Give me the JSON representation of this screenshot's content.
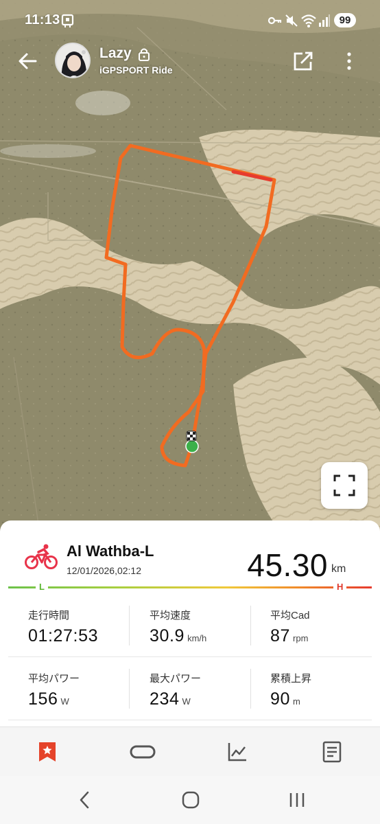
{
  "status_bar": {
    "time": "11:13",
    "battery": "99",
    "icons": [
      "app-notification-icon",
      "key-icon",
      "mute-icon",
      "wifi-icon",
      "signal-icon",
      "battery-icon"
    ]
  },
  "header": {
    "user_name": "Lazy",
    "subtitle": "iGPSPORT Ride",
    "icons": [
      "back-arrow-icon",
      "lock-icon",
      "share-icon",
      "more-vert-icon"
    ]
  },
  "map": {
    "track_color": "#f26b21",
    "start_marker_color": "#3cb04a",
    "fullscreen_icon": "fullscreen-icon"
  },
  "activity": {
    "name": "Al Wathba-L",
    "datetime": "12/01/2026,02:12",
    "distance": "45.30",
    "distance_unit": "km",
    "sport_icon": "cycling-icon",
    "sport_color": "#e8334a",
    "gradient_low_label": "L",
    "gradient_high_label": "H"
  },
  "stats": [
    {
      "label": "走行時間",
      "value": "01:27:53",
      "unit": ""
    },
    {
      "label": "平均速度",
      "value": "30.9",
      "unit": "km/h"
    },
    {
      "label": "平均Cad",
      "value": "87",
      "unit": "rpm"
    },
    {
      "label": "平均パワー",
      "value": "156",
      "unit": "W"
    },
    {
      "label": "最大パワー",
      "value": "234",
      "unit": "W"
    },
    {
      "label": "累積上昇",
      "value": "90",
      "unit": "m"
    }
  ],
  "tabs": [
    {
      "icon": "bookmark-star-icon",
      "active": true,
      "color": "#e5432a"
    },
    {
      "icon": "loop-route-icon",
      "active": false,
      "color": "#555555"
    },
    {
      "icon": "chart-line-icon",
      "active": false,
      "color": "#555555"
    },
    {
      "icon": "document-list-icon",
      "active": false,
      "color": "#555555"
    }
  ],
  "nav_bar": {
    "icons": [
      "nav-back-icon",
      "nav-home-icon",
      "nav-recents-icon"
    ]
  }
}
